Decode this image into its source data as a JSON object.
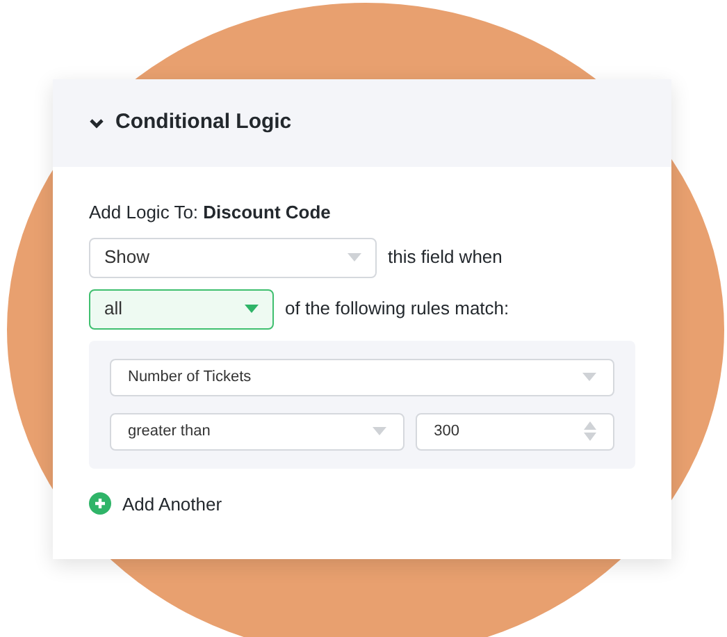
{
  "panel": {
    "title": "Conditional Logic",
    "expanded": true
  },
  "target": {
    "label": "Add Logic To:",
    "field": "Discount Code"
  },
  "action": {
    "value": "Show",
    "active": false,
    "suffix": "this field when"
  },
  "match": {
    "value": "all",
    "active": true,
    "suffix": "of the following rules match:"
  },
  "rule": {
    "field": {
      "value": "Number of Tickets",
      "active": false
    },
    "operator": {
      "value": "greater than",
      "active": false
    },
    "amount": "300"
  },
  "add_button": {
    "label": "Add Another"
  }
}
